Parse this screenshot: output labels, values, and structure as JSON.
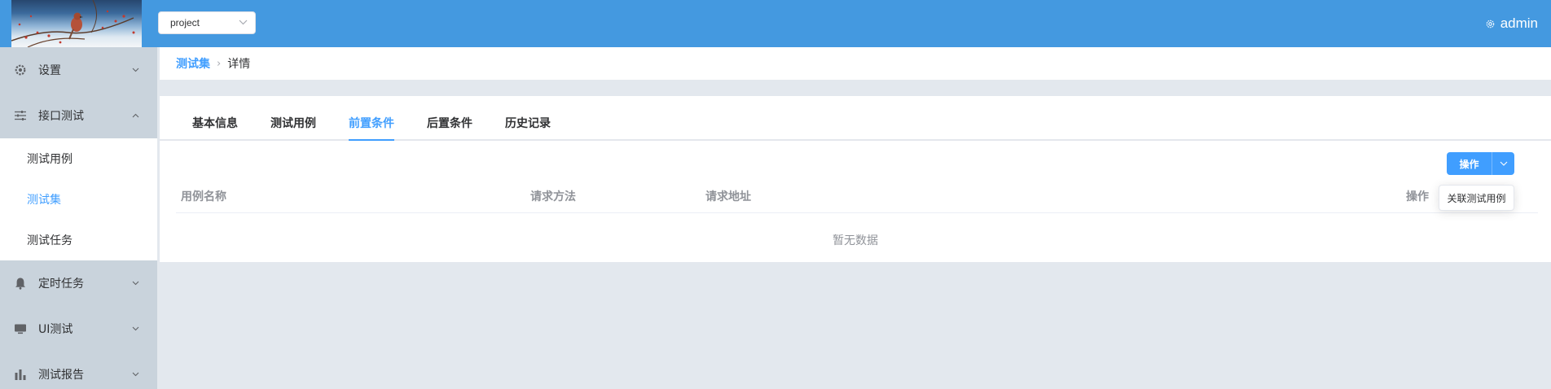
{
  "header": {
    "project_select": {
      "value": "project"
    },
    "user": {
      "name": "admin",
      "icon": "gear-icon"
    }
  },
  "sidebar": {
    "items": [
      {
        "label": "设置",
        "icon": "gear-icon",
        "expanded": false
      },
      {
        "label": "接口测试",
        "icon": "sliders-icon",
        "expanded": true,
        "children": [
          {
            "label": "测试用例",
            "active": false
          },
          {
            "label": "测试集",
            "active": true
          },
          {
            "label": "测试任务",
            "active": false
          }
        ]
      },
      {
        "label": "定时任务",
        "icon": "bell-icon",
        "expanded": false
      },
      {
        "label": "UI测试",
        "icon": "monitor-icon",
        "expanded": false
      },
      {
        "label": "测试报告",
        "icon": "bar-chart-icon",
        "expanded": false
      }
    ]
  },
  "breadcrumb": {
    "parent": "测试集",
    "current": "详情"
  },
  "tabs": [
    {
      "label": "基本信息",
      "active": false
    },
    {
      "label": "测试用例",
      "active": false
    },
    {
      "label": "前置条件",
      "active": true
    },
    {
      "label": "后置条件",
      "active": false
    },
    {
      "label": "历史记录",
      "active": false
    }
  ],
  "actions": {
    "operate_label": "操作",
    "dropdown_items": [
      "关联测试用例"
    ]
  },
  "table": {
    "columns": [
      "用例名称",
      "请求方法",
      "请求地址",
      "操作"
    ],
    "rows": [],
    "empty_text": "暂无数据"
  },
  "colors": {
    "header_bg": "#4499e0",
    "accent": "#409eff",
    "sidebar_bg": "#c9d3dc",
    "page_bg": "#e3e8ee"
  }
}
